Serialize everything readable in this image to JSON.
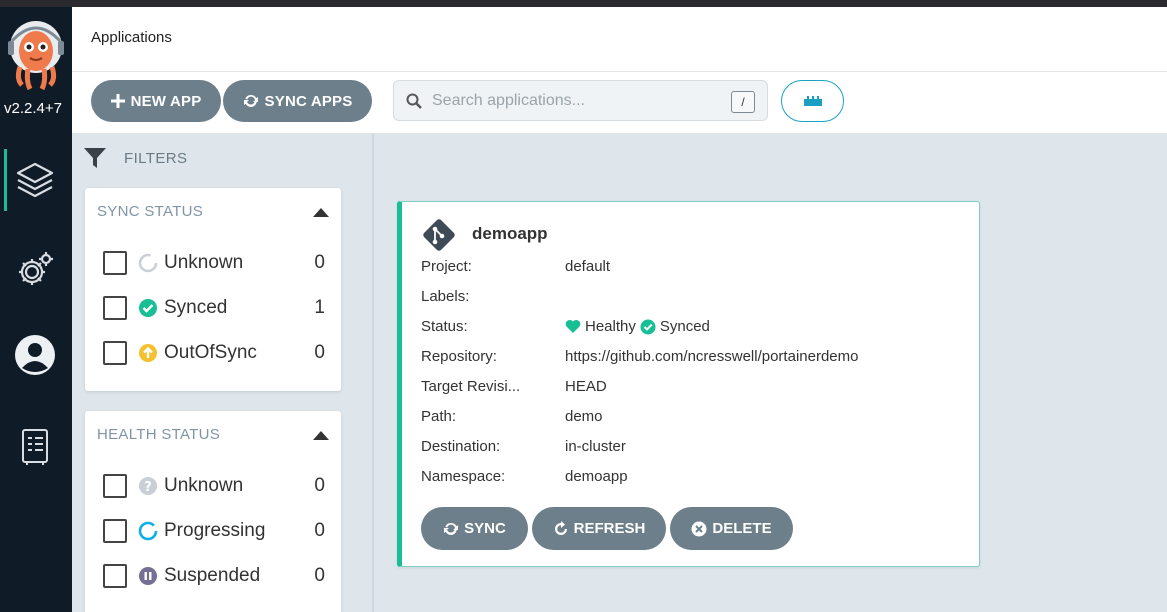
{
  "app": {
    "version": "v2.2.4+7",
    "header_title": "Applications"
  },
  "toolbar": {
    "new_app_label": "NEW APP",
    "sync_apps_label": "SYNC APPS",
    "search_placeholder": "Search applications...",
    "search_shortcut": "/"
  },
  "filters": {
    "title": "FILTERS",
    "sync_status": {
      "title": "SYNC STATUS",
      "items": [
        {
          "label": "Unknown",
          "count": "0"
        },
        {
          "label": "Synced",
          "count": "1"
        },
        {
          "label": "OutOfSync",
          "count": "0"
        }
      ]
    },
    "health_status": {
      "title": "HEALTH STATUS",
      "items": [
        {
          "label": "Unknown",
          "count": "0"
        },
        {
          "label": "Progressing",
          "count": "0"
        },
        {
          "label": "Suspended",
          "count": "0"
        }
      ]
    }
  },
  "card": {
    "name": "demoapp",
    "fields": [
      {
        "key": "Project:",
        "value": "default"
      },
      {
        "key": "Labels:",
        "value": ""
      },
      {
        "key": "Status:",
        "health": "Healthy",
        "sync": "Synced"
      },
      {
        "key": "Repository:",
        "value": "https://github.com/ncresswell/portainerdemo"
      },
      {
        "key": "Target Revisi...",
        "value": "HEAD"
      },
      {
        "key": "Path:",
        "value": "demo"
      },
      {
        "key": "Destination:",
        "value": "in-cluster"
      },
      {
        "key": "Namespace:",
        "value": "demoapp"
      }
    ],
    "actions": {
      "sync": "SYNC",
      "refresh": "REFRESH",
      "delete": "DELETE"
    }
  },
  "colors": {
    "nav_bg": "#0f1b27",
    "accent_teal": "#18be94",
    "button_gray": "#6d7f8b",
    "outofsync": "#f4c030",
    "progressing": "#0dadea",
    "suspended": "#766f94"
  }
}
